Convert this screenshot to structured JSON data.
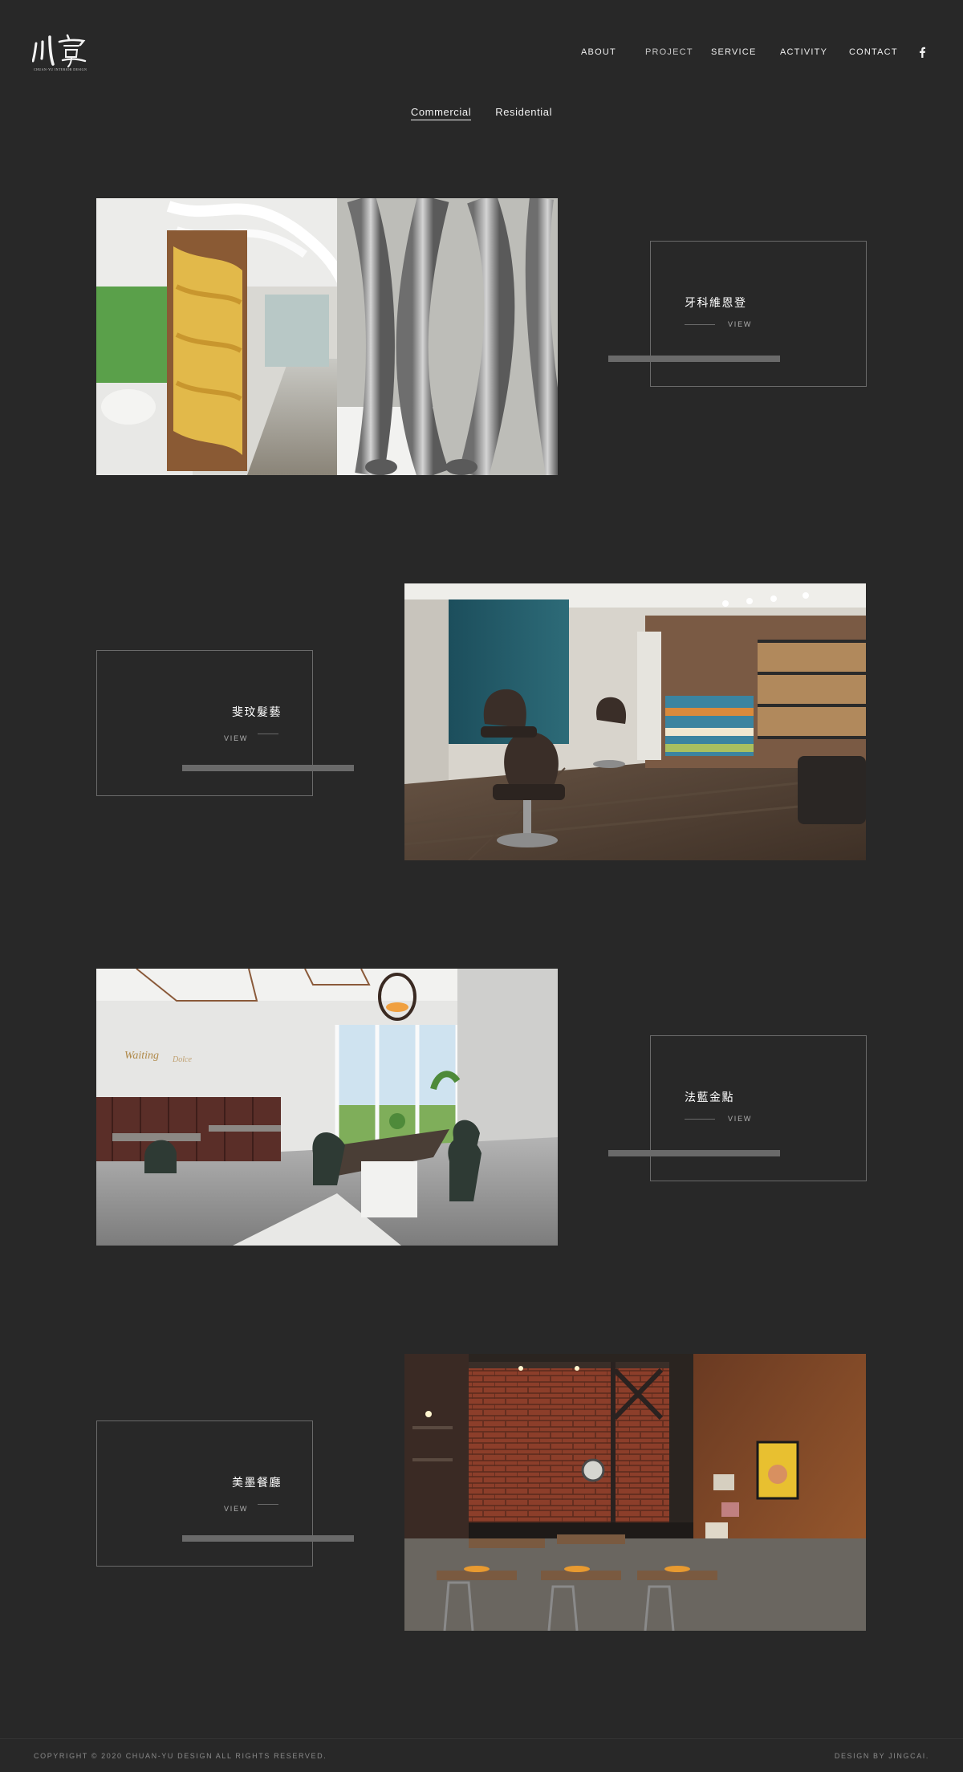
{
  "header": {
    "logo_subtitle": "CHUAN-YU INTERIOR DESIGN",
    "nav": [
      {
        "label": "ABOUT",
        "active": false
      },
      {
        "label": "PROJECT",
        "active": true
      },
      {
        "label": "SERVICE",
        "active": false
      },
      {
        "label": "ACTIVITY",
        "active": false
      },
      {
        "label": "CONTACT",
        "active": false
      }
    ],
    "social_icon": "facebook-icon"
  },
  "tabs": [
    {
      "label": "Commercial",
      "active": true
    },
    {
      "label": "Residential",
      "active": false
    }
  ],
  "projects": [
    {
      "title": "牙科維恩登",
      "view_label": "VIEW",
      "photo": "dental-clinic-corridor-photo"
    },
    {
      "title": "斐玟髮藝",
      "view_label": "VIEW",
      "photo": "hair-salon-interior-photo"
    },
    {
      "title": "法藍金點",
      "view_label": "VIEW",
      "photo": "cafe-dining-room-photo"
    },
    {
      "title": "美墨餐廳",
      "view_label": "VIEW",
      "photo": "restaurant-brick-wall-photo"
    }
  ],
  "footer": {
    "copyright": "COPYRIGHT © 2020 CHUAN-YU DESIGN ALL RIGHTS RESERVED.",
    "credit": "DESIGN BY JINGCAI."
  },
  "colors": {
    "background": "#282828",
    "card_border": "#6a6a6a",
    "accent_bar": "#6a6a6a",
    "active_nav_circle": "#505050"
  }
}
